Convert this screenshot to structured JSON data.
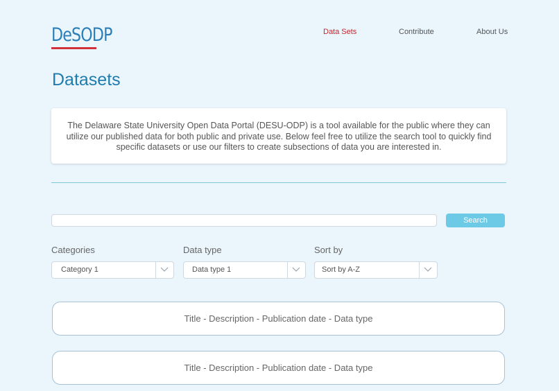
{
  "brand": {
    "logo_text": "DeSODP",
    "accent": "#1f7cae",
    "red": "#c5272e"
  },
  "nav": {
    "items": [
      {
        "label": "Data Sets",
        "active": true
      },
      {
        "label": "Contribute",
        "active": false
      },
      {
        "label": "About Us",
        "active": false
      }
    ]
  },
  "page": {
    "title": "Datasets",
    "intro": "The Delaware State University Open Data Portal (DESU-ODP) is a tool available for the public where they can utilize our published data for both public and private use. Below feel free to utilize the search tool to quickly find specific datasets or use our filters to create subsections of data you are interested in."
  },
  "search": {
    "value": "",
    "placeholder": "",
    "button_label": "Search"
  },
  "filters": [
    {
      "label": "Categories",
      "selected": "Category 1",
      "icon": "chevron-down-icon"
    },
    {
      "label": "Data type",
      "selected": "Data type 1",
      "icon": "chevron-down-icon"
    },
    {
      "label": "Sort by",
      "selected": "Sort by A-Z",
      "icon": "chevron-down-icon"
    }
  ],
  "results": [
    {
      "text": "Title - Description - Publication date - Data type"
    },
    {
      "text": "Title - Description - Publication date - Data type"
    }
  ]
}
